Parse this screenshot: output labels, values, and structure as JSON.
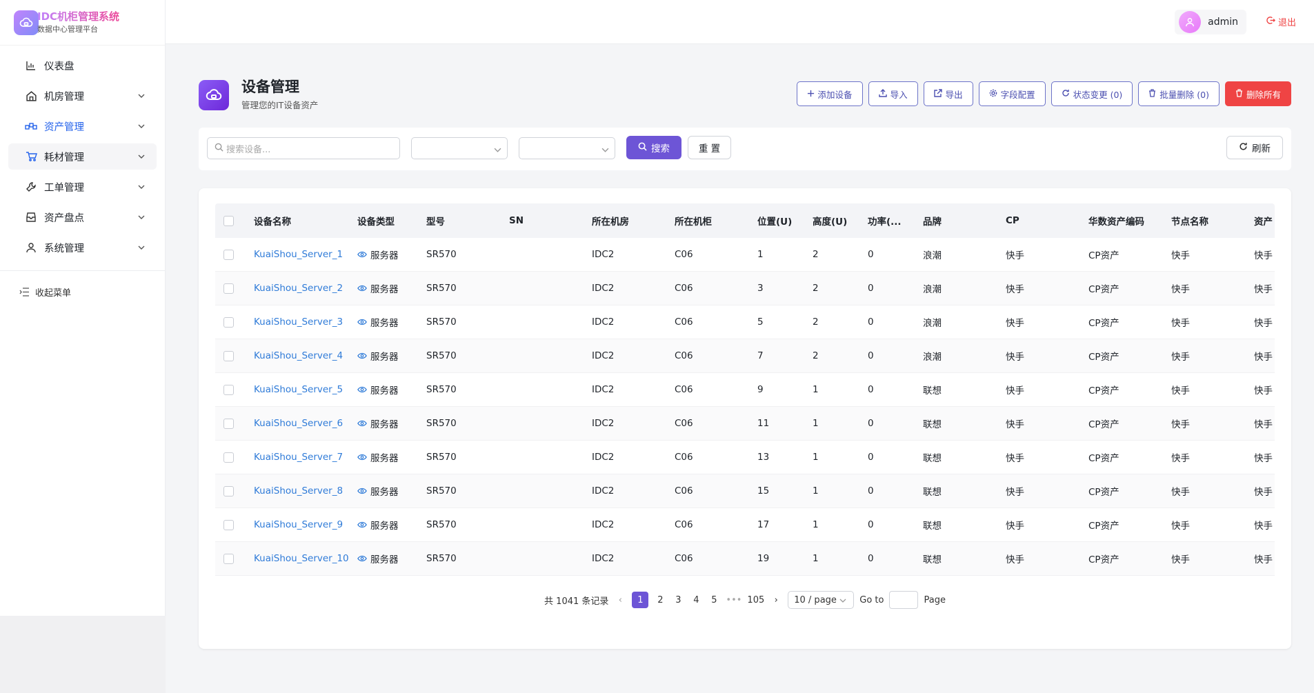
{
  "brand": {
    "title": "IDC机柜管理系统",
    "subtitle": "数据中心管理平台"
  },
  "sidebar": {
    "items": [
      {
        "label": "仪表盘",
        "icon": "chart-icon",
        "has_children": false
      },
      {
        "label": "机房管理",
        "icon": "home-icon",
        "has_children": true
      },
      {
        "label": "资产管理",
        "icon": "asset-icon",
        "has_children": true,
        "active": true
      },
      {
        "label": "耗材管理",
        "icon": "cart-icon",
        "has_children": true,
        "hover": true
      },
      {
        "label": "工单管理",
        "icon": "wrench-icon",
        "has_children": true
      },
      {
        "label": "资产盘点",
        "icon": "inbox-icon",
        "has_children": true
      },
      {
        "label": "系统管理",
        "icon": "user-icon",
        "has_children": true
      }
    ],
    "collapse_label": "收起菜单"
  },
  "topbar": {
    "username": "admin",
    "logout_label": "退出"
  },
  "page": {
    "title": "设备管理",
    "subtitle": "管理您的IT设备资产"
  },
  "actions": {
    "add": "添加设备",
    "import": "导入",
    "export": "导出",
    "fields": "字段配置",
    "status_change": "状态变更 (0)",
    "batch_delete": "批量删除 (0)",
    "delete_all": "删除所有"
  },
  "filter": {
    "search_placeholder": "搜索设备...",
    "select1_value": "",
    "select2_value": "",
    "search_label": "搜索",
    "reset_label": "重 置",
    "refresh_label": "刷新"
  },
  "table": {
    "columns": [
      "设备名称",
      "设备类型",
      "型号",
      "SN",
      "所在机房",
      "所在机柜",
      "位置(U)",
      "高度(U)",
      "功率(...",
      "品牌",
      "CP",
      "华数资产编码",
      "节点名称",
      "资产"
    ],
    "rows": [
      [
        "KuaiShou_Server_1",
        "服务器",
        "SR570",
        "",
        "IDC2",
        "C06",
        "1",
        "2",
        "0",
        "浪潮",
        "快手",
        "CP资产",
        "快手",
        "快手"
      ],
      [
        "KuaiShou_Server_2",
        "服务器",
        "SR570",
        "",
        "IDC2",
        "C06",
        "3",
        "2",
        "0",
        "浪潮",
        "快手",
        "CP资产",
        "快手",
        "快手"
      ],
      [
        "KuaiShou_Server_3",
        "服务器",
        "SR570",
        "",
        "IDC2",
        "C06",
        "5",
        "2",
        "0",
        "浪潮",
        "快手",
        "CP资产",
        "快手",
        "快手"
      ],
      [
        "KuaiShou_Server_4",
        "服务器",
        "SR570",
        "",
        "IDC2",
        "C06",
        "7",
        "2",
        "0",
        "浪潮",
        "快手",
        "CP资产",
        "快手",
        "快手"
      ],
      [
        "KuaiShou_Server_5",
        "服务器",
        "SR570",
        "",
        "IDC2",
        "C06",
        "9",
        "1",
        "0",
        "联想",
        "快手",
        "CP资产",
        "快手",
        "快手"
      ],
      [
        "KuaiShou_Server_6",
        "服务器",
        "SR570",
        "",
        "IDC2",
        "C06",
        "11",
        "1",
        "0",
        "联想",
        "快手",
        "CP资产",
        "快手",
        "快手"
      ],
      [
        "KuaiShou_Server_7",
        "服务器",
        "SR570",
        "",
        "IDC2",
        "C06",
        "13",
        "1",
        "0",
        "联想",
        "快手",
        "CP资产",
        "快手",
        "快手"
      ],
      [
        "KuaiShou_Server_8",
        "服务器",
        "SR570",
        "",
        "IDC2",
        "C06",
        "15",
        "1",
        "0",
        "联想",
        "快手",
        "CP资产",
        "快手",
        "快手"
      ],
      [
        "KuaiShou_Server_9",
        "服务器",
        "SR570",
        "",
        "IDC2",
        "C06",
        "17",
        "1",
        "0",
        "联想",
        "快手",
        "CP资产",
        "快手",
        "快手"
      ],
      [
        "KuaiShou_Server_10",
        "服务器",
        "SR570",
        "",
        "IDC2",
        "C06",
        "19",
        "1",
        "0",
        "联想",
        "快手",
        "CP资产",
        "快手",
        "快手"
      ]
    ]
  },
  "pagination": {
    "total_label": "共 1041 条记录",
    "pages": [
      "1",
      "2",
      "3",
      "4",
      "5"
    ],
    "current": "1",
    "ellipsis": "•••",
    "last_page": "105",
    "page_size": "10 / page",
    "goto_label": "Go to",
    "page_label": "Page"
  },
  "colors": {
    "accent": "#6d55d6",
    "link": "#2f7bd8",
    "danger": "#ef4444"
  }
}
